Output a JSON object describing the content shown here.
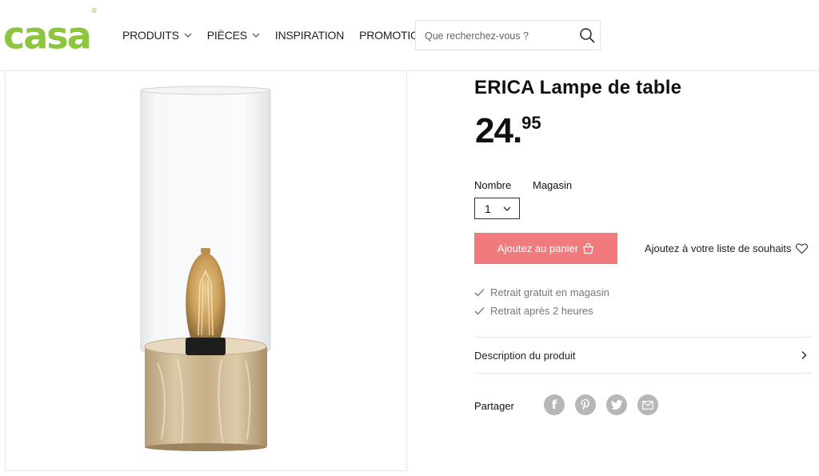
{
  "header": {
    "logo": "casa",
    "logo_mark": "®",
    "logo_color": "#8cc63f",
    "nav": [
      {
        "label": "PRODUITS",
        "has_dropdown": true
      },
      {
        "label": "PIÈCES",
        "has_dropdown": true
      },
      {
        "label": "INSPIRATION",
        "has_dropdown": false
      },
      {
        "label": "PROMOTIONS",
        "has_dropdown": false
      }
    ],
    "search": {
      "placeholder": "Que recherchez-vous ?",
      "value": "",
      "icon": "search-icon"
    }
  },
  "product": {
    "title": "ERICA Lampe de table",
    "price_int": "24.",
    "price_cents": "95",
    "quantity_label": "Nombre",
    "store_label": "Magasin",
    "quantity_value": "1",
    "add_to_cart": "Ajoutez au panier",
    "wishlist": "Ajoutez à votre liste de souhaits",
    "perks": [
      "Retrait gratuit en magasin",
      "Retrait après 2 heures"
    ],
    "description_label": "Description du produit",
    "share_label": "Partager",
    "share_icons": [
      "facebook-icon",
      "pinterest-icon",
      "twitter-icon",
      "email-icon"
    ]
  },
  "colors": {
    "accent": "#f17a7d",
    "brand_green": "#8cc63f",
    "share_grey": "#b7b7b7"
  }
}
